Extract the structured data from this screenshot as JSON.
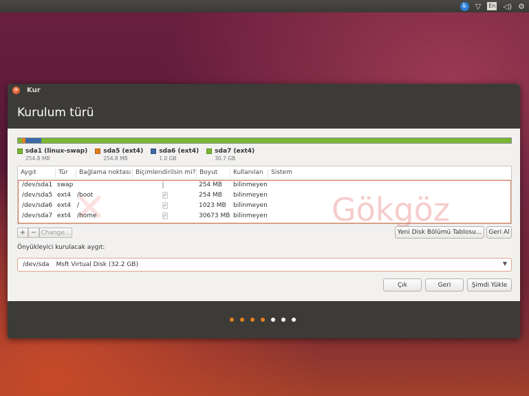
{
  "topbar": {
    "lang": "En",
    "icons": [
      "accessibility-icon",
      "wifi-icon",
      "keyboard-lang-indicator",
      "volume-icon",
      "settings-gear-icon"
    ],
    "glyphs": [
      "♿",
      "▽",
      "En",
      "◁)",
      "⚙"
    ]
  },
  "window": {
    "title": "Kur",
    "heading": "Kurulum türü"
  },
  "usage_bar": {
    "segments": [
      {
        "color": "#7ab733",
        "fraction": 0.008
      },
      {
        "color": "#e5801e",
        "fraction": 0.008
      },
      {
        "color": "#3c6aa8",
        "fraction": 0.032
      },
      {
        "color": "#7ab733",
        "fraction": 0.952
      }
    ]
  },
  "legend": [
    {
      "label": "sda1 (linux-swap)",
      "size": "254.8 MB",
      "color": "#7ab733"
    },
    {
      "label": "sda5 (ext4)",
      "size": "254.8 MB",
      "color": "#e5801e"
    },
    {
      "label": "sda6 (ext4)",
      "size": "1.0 GB",
      "color": "#3c6aa8"
    },
    {
      "label": "sda7 (ext4)",
      "size": "30.7 GB",
      "color": "#7ab733"
    }
  ],
  "table": {
    "headers": [
      "Aygıt",
      "Tür",
      "Bağlama noktası",
      "Biçimlendirilsin mi?",
      "Boyut",
      "Kullanılan",
      "Sistem"
    ],
    "rows": [
      {
        "device": "/dev/sda1",
        "type": "swap",
        "mount": "",
        "format": false,
        "size": "254 MB",
        "used": "bilinmeyen",
        "system": ""
      },
      {
        "device": "/dev/sda5",
        "type": "ext4",
        "mount": "/boot",
        "format": true,
        "size": "254 MB",
        "used": "bilinmeyen",
        "system": ""
      },
      {
        "device": "/dev/sda6",
        "type": "ext4",
        "mount": "/",
        "format": true,
        "size": "1023 MB",
        "used": "bilinmeyen",
        "system": ""
      },
      {
        "device": "/dev/sda7",
        "type": "ext4",
        "mount": "/home",
        "format": true,
        "size": "30673 MB",
        "used": "bilinmeyen",
        "system": ""
      }
    ]
  },
  "watermark": {
    "text": "Gökgöz"
  },
  "tools": {
    "add": "+",
    "remove": "−",
    "change": "Change...",
    "new_table": "Yeni Disk Bölümü Tablosu...",
    "revert": "Geri Al"
  },
  "boot": {
    "label": "Önyükleyici kurulacak aygıt:",
    "device": "/dev/sda",
    "desc": "Msft Virtual Disk (32.2 GB)",
    "arrow": "▼"
  },
  "buttons": {
    "quit": "Çık",
    "back": "Geri",
    "install": "Şimdi Yükle"
  },
  "progress": {
    "steps_total": 7,
    "steps_done": 4,
    "done_color": "#e5801e",
    "todo_color": "#ffffff"
  }
}
